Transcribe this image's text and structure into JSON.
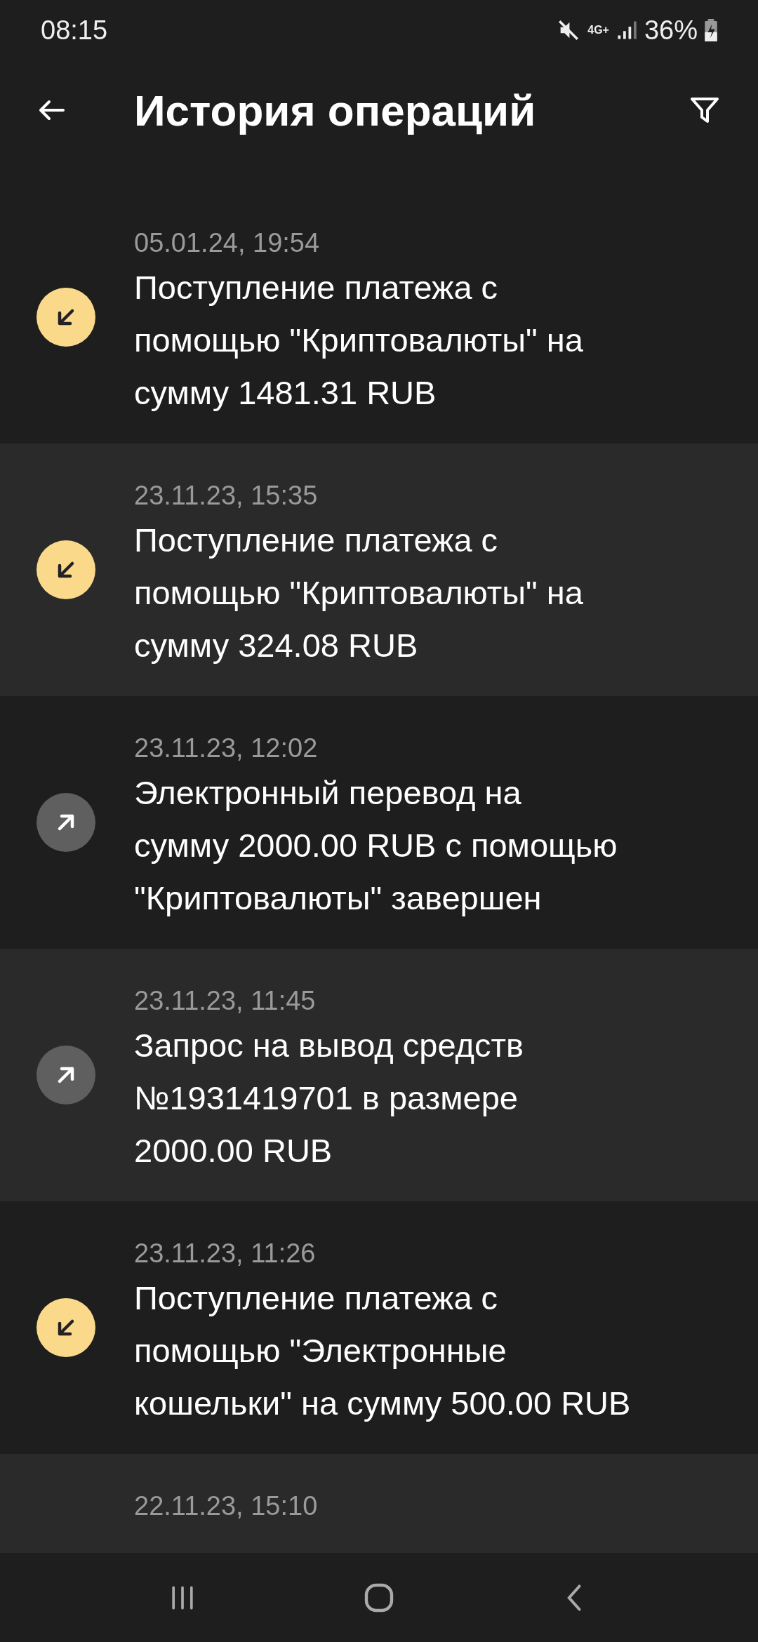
{
  "status_bar": {
    "time": "08:15",
    "network": "4G+",
    "battery": "36%"
  },
  "header": {
    "title": "История операций"
  },
  "operations": [
    {
      "date": "05.01.24, 19:54",
      "text_lines": [
        "Поступление платежа с",
        "помощью \"Криптовалюты\" на",
        "сумму 1481.31 RUB"
      ],
      "kind": "incoming"
    },
    {
      "date": "23.11.23, 15:35",
      "text_lines": [
        "Поступление платежа с",
        "помощью \"Криптовалюты\" на",
        "сумму 324.08 RUB"
      ],
      "kind": "incoming"
    },
    {
      "date": "23.11.23, 12:02",
      "text_lines": [
        "Электронный перевод на",
        "сумму 2000.00 RUB с помощью",
        "\"Криптовалюты\" завершен"
      ],
      "kind": "outgoing"
    },
    {
      "date": "23.11.23, 11:45",
      "text_lines": [
        "Запрос на вывод средств",
        "№1931419701 в размере",
        "2000.00 RUB"
      ],
      "kind": "outgoing"
    },
    {
      "date": "23.11.23, 11:26",
      "text_lines": [
        "Поступление платежа с",
        "помощью \"Электронные",
        "кошельки\" на сумму 500.00 RUB"
      ],
      "kind": "incoming"
    },
    {
      "date": "22.11.23, 15:10"
    }
  ]
}
